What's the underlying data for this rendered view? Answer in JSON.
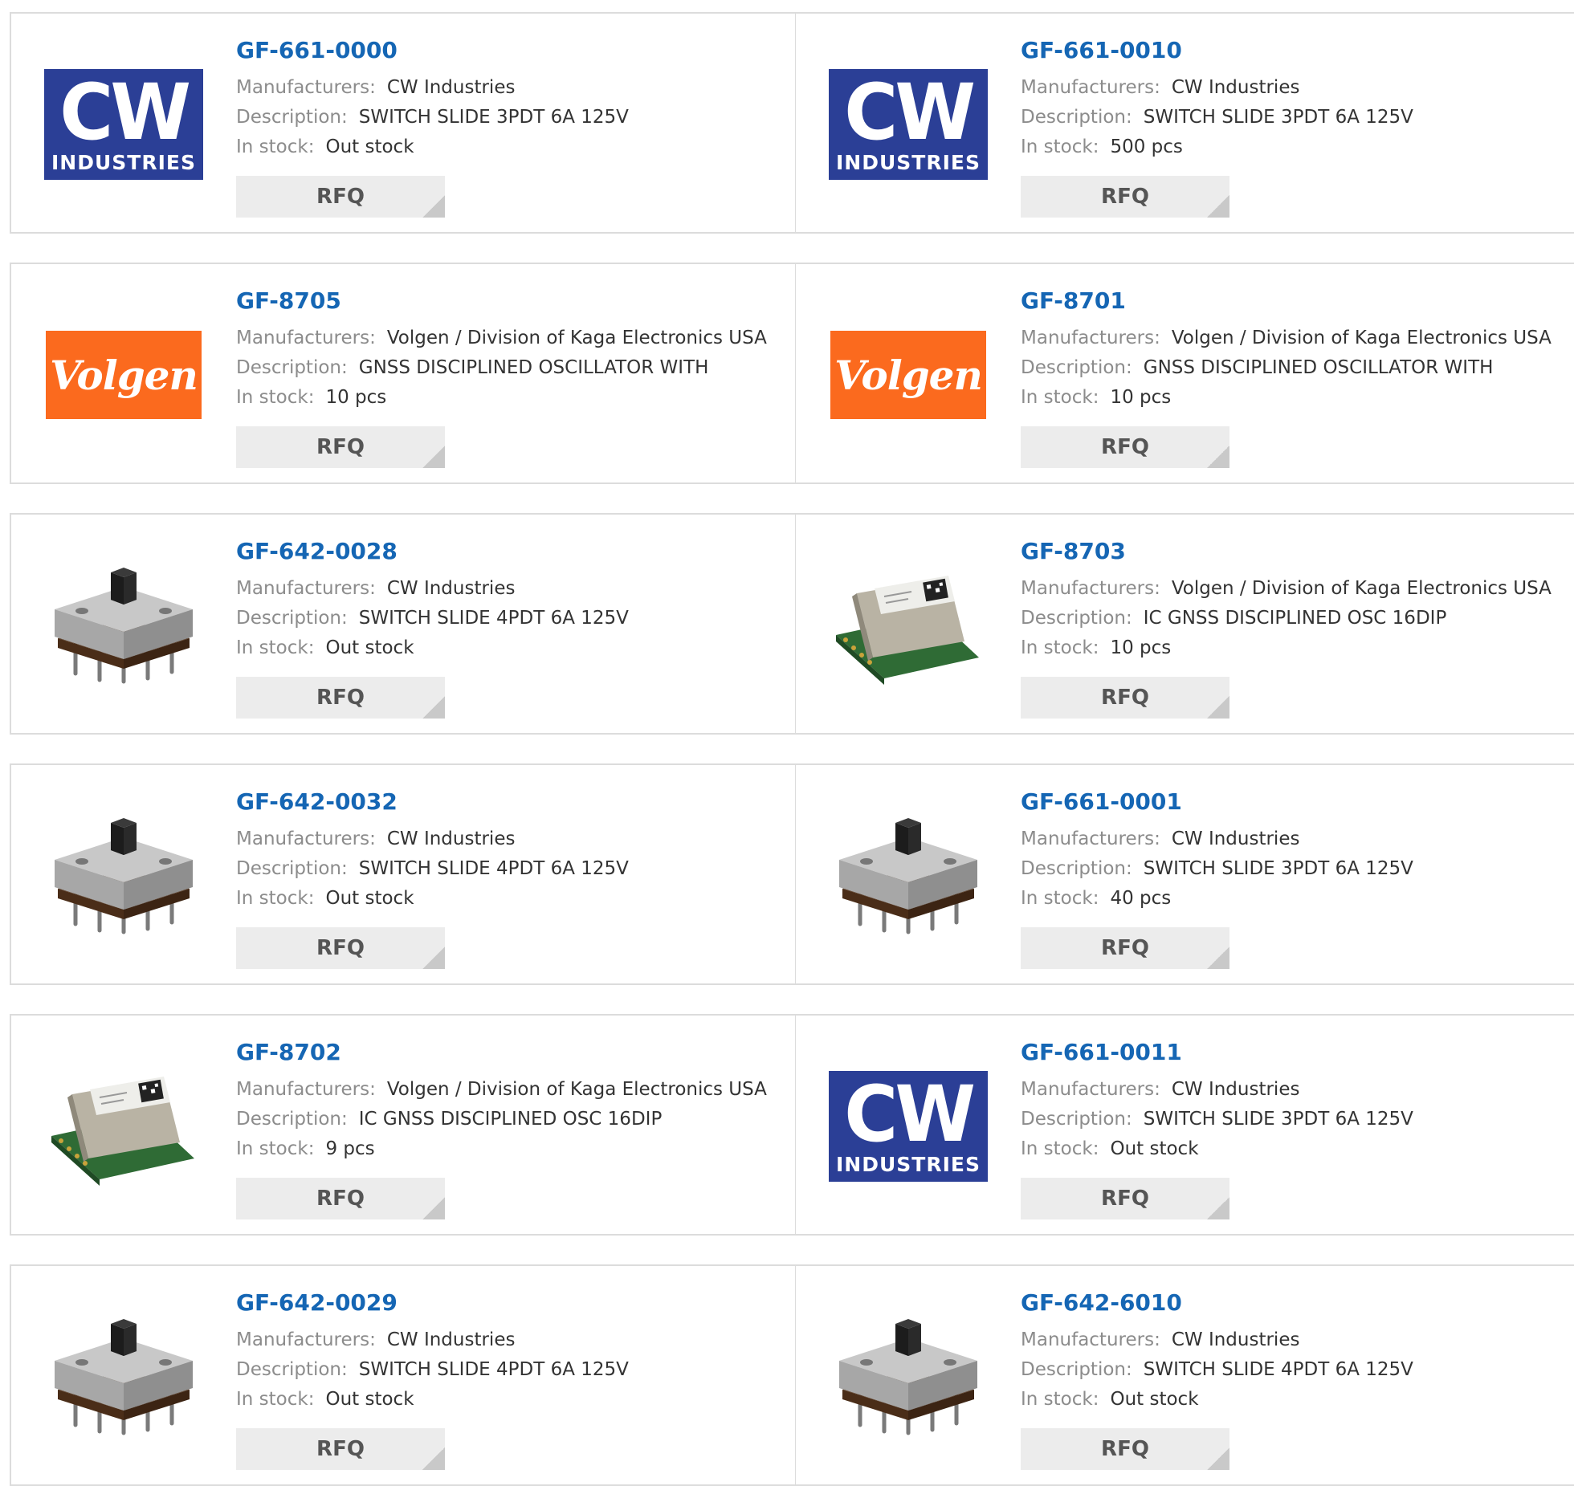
{
  "labels": {
    "manufacturers": "Manufacturers:",
    "description": "Description:",
    "in_stock": "In stock:",
    "rfq": "RFQ"
  },
  "colors": {
    "part_link": "#1566b4",
    "cw_logo_bg": "#2b3f96",
    "volgen_logo_bg": "#fb6a1e"
  },
  "products": [
    {
      "part": "GF-661-0000",
      "manufacturer": "CW Industries",
      "description": "SWITCH SLIDE 3PDT 6A 125V",
      "stock": "Out stock",
      "image": "cw-logo",
      "logo_text": "CW",
      "logo_sub": "INDUSTRIES"
    },
    {
      "part": "GF-661-0010",
      "manufacturer": "CW Industries",
      "description": "SWITCH SLIDE 3PDT 6A 125V",
      "stock": "500 pcs",
      "image": "cw-logo",
      "logo_text": "CW",
      "logo_sub": "INDUSTRIES"
    },
    {
      "part": "GF-8705",
      "manufacturer": "Volgen / Division of Kaga Electronics USA",
      "description": "GNSS DISCIPLINED OSCILLATOR WITH",
      "stock": "10 pcs",
      "image": "volgen-logo",
      "logo_text": "Volgen"
    },
    {
      "part": "GF-8701",
      "manufacturer": "Volgen / Division of Kaga Electronics USA",
      "description": "GNSS DISCIPLINED OSCILLATOR WITH",
      "stock": "10 pcs",
      "image": "volgen-logo",
      "logo_text": "Volgen"
    },
    {
      "part": "GF-642-0028",
      "manufacturer": "CW Industries",
      "description": "SWITCH SLIDE 4PDT 6A 125V",
      "stock": "Out stock",
      "image": "slide-switch-photo"
    },
    {
      "part": "GF-8703",
      "manufacturer": "Volgen / Division of Kaga Electronics USA",
      "description": "IC GNSS DISCIPLINED OSC 16DIP",
      "stock": "10 pcs",
      "image": "oscillator-module-photo"
    },
    {
      "part": "GF-642-0032",
      "manufacturer": "CW Industries",
      "description": "SWITCH SLIDE 4PDT 6A 125V",
      "stock": "Out stock",
      "image": "slide-switch-photo"
    },
    {
      "part": "GF-661-0001",
      "manufacturer": "CW Industries",
      "description": "SWITCH SLIDE 3PDT 6A 125V",
      "stock": "40 pcs",
      "image": "slide-switch-photo"
    },
    {
      "part": "GF-8702",
      "manufacturer": "Volgen / Division of Kaga Electronics USA",
      "description": "IC GNSS DISCIPLINED OSC 16DIP",
      "stock": "9 pcs",
      "image": "oscillator-module-photo"
    },
    {
      "part": "GF-661-0011",
      "manufacturer": "CW Industries",
      "description": "SWITCH SLIDE 3PDT 6A 125V",
      "stock": "Out stock",
      "image": "cw-logo",
      "logo_text": "CW",
      "logo_sub": "INDUSTRIES"
    },
    {
      "part": "GF-642-0029",
      "manufacturer": "CW Industries",
      "description": "SWITCH SLIDE 4PDT 6A 125V",
      "stock": "Out stock",
      "image": "slide-switch-photo"
    },
    {
      "part": "GF-642-6010",
      "manufacturer": "CW Industries",
      "description": "SWITCH SLIDE 4PDT 6A 125V",
      "stock": "Out stock",
      "image": "slide-switch-photo"
    }
  ]
}
